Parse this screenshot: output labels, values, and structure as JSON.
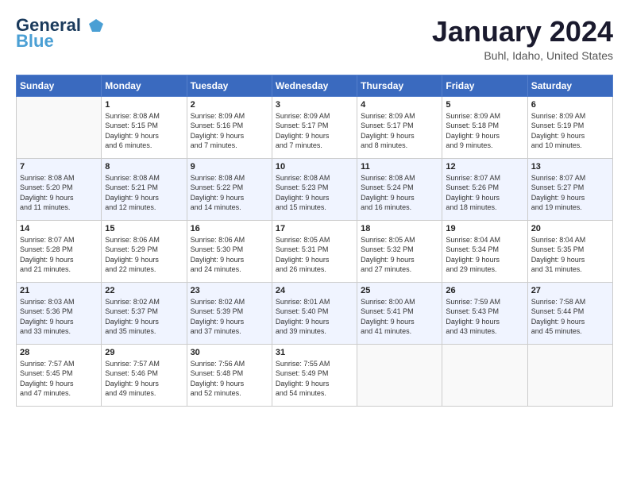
{
  "header": {
    "logo_line1": "General",
    "logo_line2": "Blue",
    "title": "January 2024",
    "location": "Buhl, Idaho, United States"
  },
  "days_of_week": [
    "Sunday",
    "Monday",
    "Tuesday",
    "Wednesday",
    "Thursday",
    "Friday",
    "Saturday"
  ],
  "weeks": [
    [
      {
        "day": "",
        "info": ""
      },
      {
        "day": "1",
        "info": "Sunrise: 8:08 AM\nSunset: 5:15 PM\nDaylight: 9 hours\nand 6 minutes."
      },
      {
        "day": "2",
        "info": "Sunrise: 8:09 AM\nSunset: 5:16 PM\nDaylight: 9 hours\nand 7 minutes."
      },
      {
        "day": "3",
        "info": "Sunrise: 8:09 AM\nSunset: 5:17 PM\nDaylight: 9 hours\nand 7 minutes."
      },
      {
        "day": "4",
        "info": "Sunrise: 8:09 AM\nSunset: 5:17 PM\nDaylight: 9 hours\nand 8 minutes."
      },
      {
        "day": "5",
        "info": "Sunrise: 8:09 AM\nSunset: 5:18 PM\nDaylight: 9 hours\nand 9 minutes."
      },
      {
        "day": "6",
        "info": "Sunrise: 8:09 AM\nSunset: 5:19 PM\nDaylight: 9 hours\nand 10 minutes."
      }
    ],
    [
      {
        "day": "7",
        "info": "Sunrise: 8:08 AM\nSunset: 5:20 PM\nDaylight: 9 hours\nand 11 minutes."
      },
      {
        "day": "8",
        "info": "Sunrise: 8:08 AM\nSunset: 5:21 PM\nDaylight: 9 hours\nand 12 minutes."
      },
      {
        "day": "9",
        "info": "Sunrise: 8:08 AM\nSunset: 5:22 PM\nDaylight: 9 hours\nand 14 minutes."
      },
      {
        "day": "10",
        "info": "Sunrise: 8:08 AM\nSunset: 5:23 PM\nDaylight: 9 hours\nand 15 minutes."
      },
      {
        "day": "11",
        "info": "Sunrise: 8:08 AM\nSunset: 5:24 PM\nDaylight: 9 hours\nand 16 minutes."
      },
      {
        "day": "12",
        "info": "Sunrise: 8:07 AM\nSunset: 5:26 PM\nDaylight: 9 hours\nand 18 minutes."
      },
      {
        "day": "13",
        "info": "Sunrise: 8:07 AM\nSunset: 5:27 PM\nDaylight: 9 hours\nand 19 minutes."
      }
    ],
    [
      {
        "day": "14",
        "info": "Sunrise: 8:07 AM\nSunset: 5:28 PM\nDaylight: 9 hours\nand 21 minutes."
      },
      {
        "day": "15",
        "info": "Sunrise: 8:06 AM\nSunset: 5:29 PM\nDaylight: 9 hours\nand 22 minutes."
      },
      {
        "day": "16",
        "info": "Sunrise: 8:06 AM\nSunset: 5:30 PM\nDaylight: 9 hours\nand 24 minutes."
      },
      {
        "day": "17",
        "info": "Sunrise: 8:05 AM\nSunset: 5:31 PM\nDaylight: 9 hours\nand 26 minutes."
      },
      {
        "day": "18",
        "info": "Sunrise: 8:05 AM\nSunset: 5:32 PM\nDaylight: 9 hours\nand 27 minutes."
      },
      {
        "day": "19",
        "info": "Sunrise: 8:04 AM\nSunset: 5:34 PM\nDaylight: 9 hours\nand 29 minutes."
      },
      {
        "day": "20",
        "info": "Sunrise: 8:04 AM\nSunset: 5:35 PM\nDaylight: 9 hours\nand 31 minutes."
      }
    ],
    [
      {
        "day": "21",
        "info": "Sunrise: 8:03 AM\nSunset: 5:36 PM\nDaylight: 9 hours\nand 33 minutes."
      },
      {
        "day": "22",
        "info": "Sunrise: 8:02 AM\nSunset: 5:37 PM\nDaylight: 9 hours\nand 35 minutes."
      },
      {
        "day": "23",
        "info": "Sunrise: 8:02 AM\nSunset: 5:39 PM\nDaylight: 9 hours\nand 37 minutes."
      },
      {
        "day": "24",
        "info": "Sunrise: 8:01 AM\nSunset: 5:40 PM\nDaylight: 9 hours\nand 39 minutes."
      },
      {
        "day": "25",
        "info": "Sunrise: 8:00 AM\nSunset: 5:41 PM\nDaylight: 9 hours\nand 41 minutes."
      },
      {
        "day": "26",
        "info": "Sunrise: 7:59 AM\nSunset: 5:43 PM\nDaylight: 9 hours\nand 43 minutes."
      },
      {
        "day": "27",
        "info": "Sunrise: 7:58 AM\nSunset: 5:44 PM\nDaylight: 9 hours\nand 45 minutes."
      }
    ],
    [
      {
        "day": "28",
        "info": "Sunrise: 7:57 AM\nSunset: 5:45 PM\nDaylight: 9 hours\nand 47 minutes."
      },
      {
        "day": "29",
        "info": "Sunrise: 7:57 AM\nSunset: 5:46 PM\nDaylight: 9 hours\nand 49 minutes."
      },
      {
        "day": "30",
        "info": "Sunrise: 7:56 AM\nSunset: 5:48 PM\nDaylight: 9 hours\nand 52 minutes."
      },
      {
        "day": "31",
        "info": "Sunrise: 7:55 AM\nSunset: 5:49 PM\nDaylight: 9 hours\nand 54 minutes."
      },
      {
        "day": "",
        "info": ""
      },
      {
        "day": "",
        "info": ""
      },
      {
        "day": "",
        "info": ""
      }
    ]
  ]
}
